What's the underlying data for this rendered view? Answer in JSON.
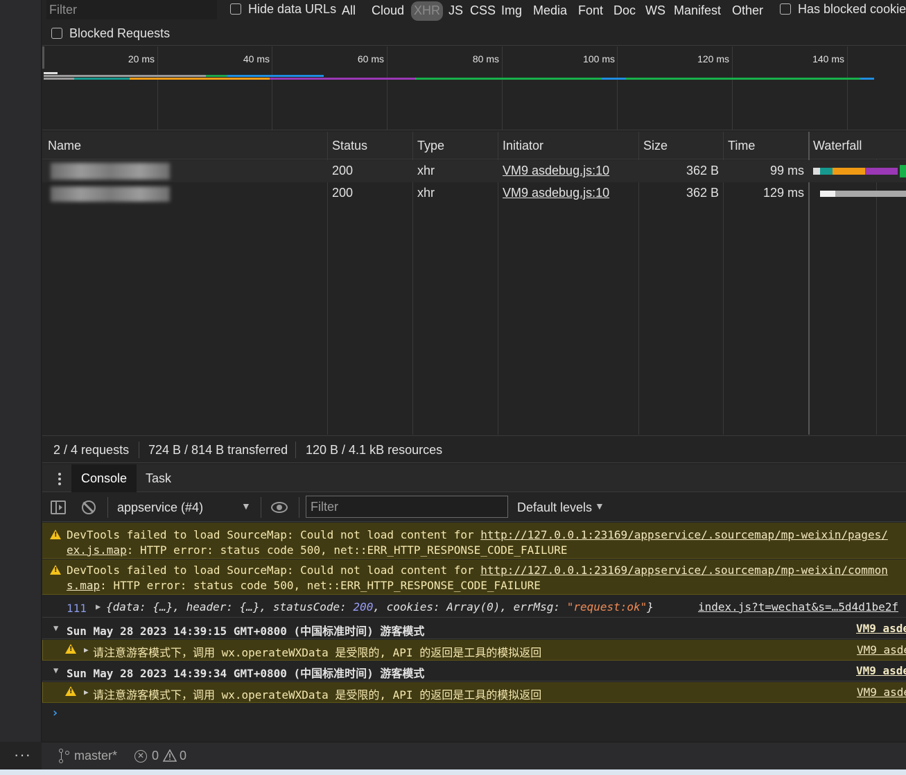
{
  "filter": {
    "placeholder": "Filter",
    "hide_data_urls": "Hide data URLs",
    "has_blocked_cookies": "Has blocked cookies",
    "blocked_requests": "Blocked Requests"
  },
  "type_filters": [
    "All",
    "Cloud",
    "XHR",
    "JS",
    "CSS",
    "Img",
    "Media",
    "Font",
    "Doc",
    "WS",
    "Manifest",
    "Other"
  ],
  "active_type": "XHR",
  "overview": {
    "ticks": [
      "20 ms",
      "40 ms",
      "60 ms",
      "80 ms",
      "100 ms",
      "120 ms",
      "140 ms"
    ]
  },
  "table": {
    "columns": {
      "name": "Name",
      "status": "Status",
      "type": "Type",
      "initiator": "Initiator",
      "size": "Size",
      "time": "Time",
      "waterfall": "Waterfall"
    },
    "rows": [
      {
        "status": "200",
        "type": "xhr",
        "initiator": "VM9 asdebug.js:10",
        "size": "362 B",
        "time": "99 ms"
      },
      {
        "status": "200",
        "type": "xhr",
        "initiator": "VM9 asdebug.js:10",
        "size": "362 B",
        "time": "129 ms"
      }
    ]
  },
  "summary": {
    "requests": "2 / 4 requests",
    "transferred": "724 B / 814 B transferred",
    "resources": "120 B / 4.1 kB resources"
  },
  "drawer": {
    "tabs": [
      "Console",
      "Task"
    ],
    "active_tab": "Console"
  },
  "console_toolbar": {
    "context": "appservice (#4)",
    "filter_placeholder": "Filter",
    "levels": "Default levels"
  },
  "messages": {
    "warn1_prefix": "DevTools failed to load SourceMap: Could not load content for ",
    "warn1_url": "http://127.0.0.1:23169/appservice/.sourcemap/mp-weixin/pages/",
    "warn1_url_cont": "ex.js.map",
    "warn1_suffix": ": HTTP error: status code 500, net::ERR_HTTP_RESPONSE_CODE_FAILURE",
    "warn2_prefix": "DevTools failed to load SourceMap: Could not load content for ",
    "warn2_url": "http://127.0.0.1:23169/appservice/.sourcemap/mp-weixin/common",
    "warn2_url_cont": "s.map",
    "warn2_suffix": ": HTTP error: status code 500, net::ERR_HTTP_RESPONSE_CODE_FAILURE",
    "log_count": "111",
    "log_text_a": "{data: {…}, header: {…}, statusCode: ",
    "log_status": "200",
    "log_text_b": ", cookies: Array(0), errMsg: ",
    "log_errmsg": "\"request:ok\"",
    "log_text_c": "}",
    "log_source": "index.js?t=wechat&s=…5d4d1be2f",
    "group1": "Sun May 28 2023 14:39:15 GMT+0800 (中国标准时间) 游客模式",
    "group1_src": "VM9 asde",
    "group1_warn": "请注意游客模式下，调用 wx.operateWXData 是受限的, API 的返回是工具的模拟返回",
    "group1_warn_src": "VM9 asde",
    "group2": "Sun May 28 2023 14:39:34 GMT+0800 (中国标准时间) 游客模式",
    "group2_src": "VM9 asde",
    "group2_warn": "请注意游客模式下，调用 wx.operateWXData 是受限的, API 的返回是工具的模拟返回",
    "group2_warn_src": "VM9 asde"
  },
  "statusbar": {
    "branch": "master*",
    "errors": "0",
    "warnings": "0"
  }
}
